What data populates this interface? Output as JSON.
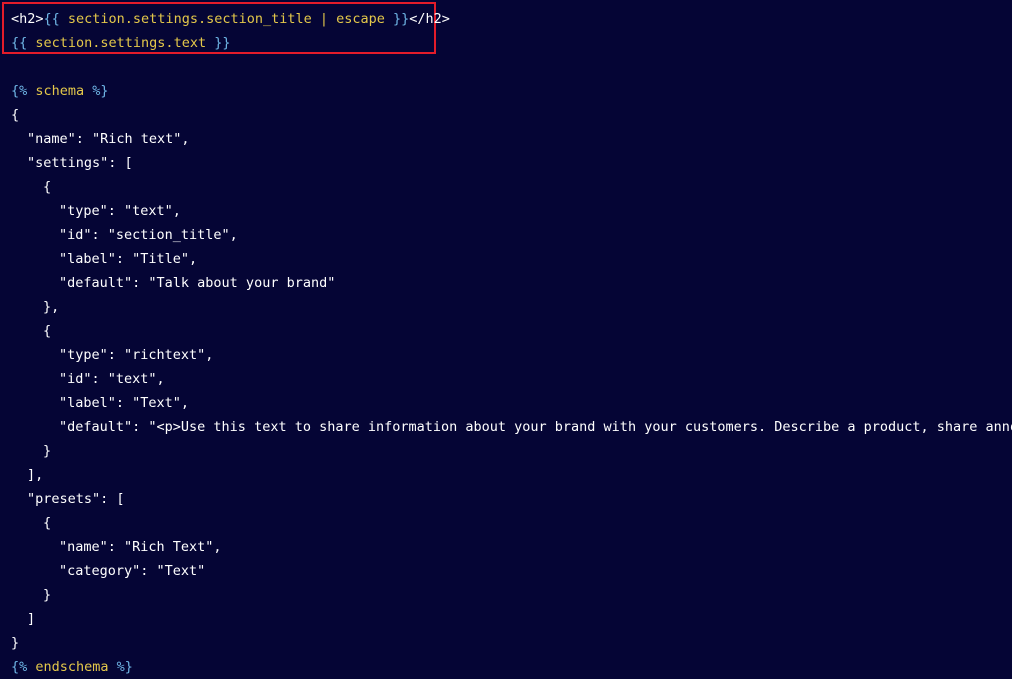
{
  "colors": {
    "background": "#050535",
    "highlight_border": "#e31c2a",
    "liquid_keyword": "#e4c84a",
    "liquid_delimiter": "#6fb6e6",
    "text": "#ffffff"
  },
  "template": {
    "h2_open": "<h2>",
    "h2_close": "</h2>",
    "title_open": "{{",
    "title_expr": " section.settings.section_title | escape ",
    "title_close": "}}",
    "text_open": "{{",
    "text_expr": " section.settings.text ",
    "text_close": "}}"
  },
  "schema": {
    "open_tag_start": "{%",
    "open_tag_word": " schema ",
    "open_tag_end": "%}",
    "close_tag_start": "{%",
    "close_tag_word": " endschema ",
    "close_tag_end": "%}",
    "lines": [
      "{",
      "\"name\": \"Rich text\",",
      "\"settings\": [",
      "{",
      "\"type\": \"text\",",
      "\"id\": \"section_title\",",
      "\"label\": \"Title\",",
      "\"default\": \"Talk about your brand\"",
      "},",
      "{",
      "\"type\": \"richtext\",",
      "\"id\": \"text\",",
      "\"label\": \"Text\",",
      "\"default\": \"<p>Use this text to share information about your brand with your customers. Describe a product, share announcem",
      "}",
      "],",
      "\"presets\": [",
      "{",
      "\"name\": \"Rich Text\",",
      "\"category\": \"Text\"",
      "}",
      "]",
      "}"
    ]
  }
}
